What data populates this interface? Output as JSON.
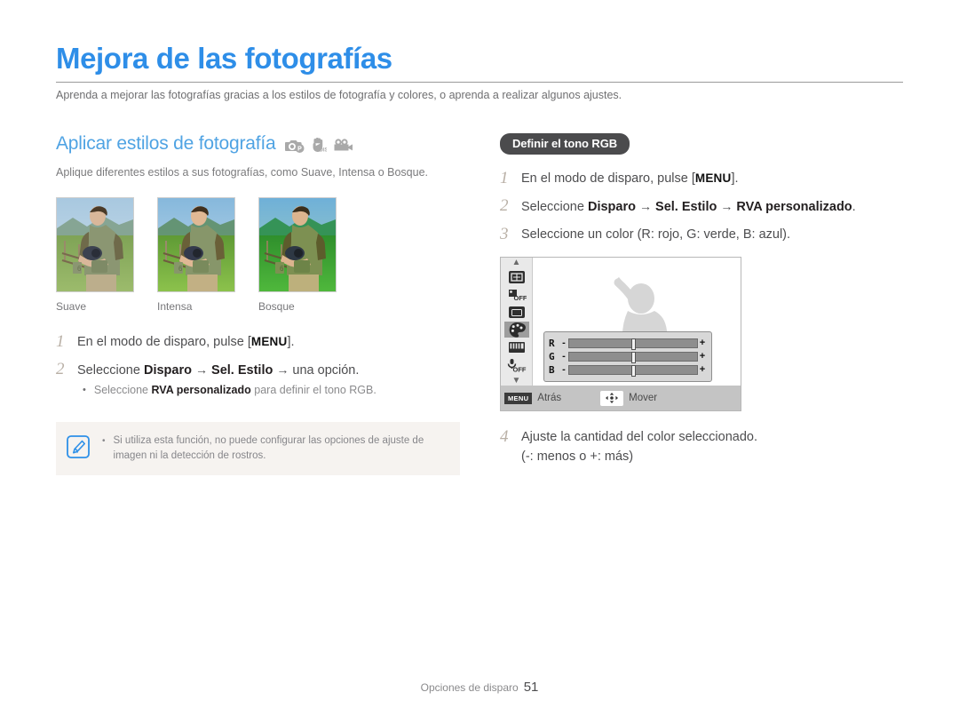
{
  "header": {
    "title": "Mejora de las fotografías",
    "intro": "Aprenda a mejorar las fotografías gracias a los estilos de fotografía y colores, o aprenda a realizar algunos ajustes."
  },
  "left": {
    "section_title": "Aplicar estilos de fotografía",
    "mode_icons": [
      "camera-p-icon",
      "hand-dis-icon",
      "video-camera-icon"
    ],
    "description": "Aplique diferentes estilos a sus fotografías, como Suave, Intensa o Bosque.",
    "thumbnails": [
      {
        "caption": "Suave"
      },
      {
        "caption": "Intensa"
      },
      {
        "caption": "Bosque"
      }
    ],
    "steps": [
      {
        "num": "1",
        "text_before": "En el modo de disparo, pulse [",
        "key": "MENU",
        "text_after": "]."
      },
      {
        "num": "2",
        "lead": "Seleccione ",
        "b1": "Disparo",
        "arrow1": "→",
        "b2": "Sel. Estilo",
        "arrow2": "→",
        "tail": "una opción.",
        "sub_bullet": "•",
        "sub_before": "Seleccione ",
        "sub_bold": "RVA personalizado",
        "sub_after": " para definir el tono RGB."
      }
    ],
    "note": {
      "icon": "note-pen-icon",
      "bullet": "•",
      "text": "Si utiliza esta función, no puede configurar las opciones de ajuste de imagen ni la detección de rostros."
    }
  },
  "right": {
    "badge": "Definir el tono RGB",
    "steps": [
      {
        "num": "1",
        "text_before": "En el modo de disparo, pulse [",
        "key": "MENU",
        "text_after": "]."
      },
      {
        "num": "2",
        "lead": "Seleccione ",
        "b1": "Disparo",
        "arrow1": "→",
        "b2": "Sel. Estilo",
        "arrow2": "→",
        "b3": "RVA personalizado",
        "tail": "."
      },
      {
        "num": "3",
        "text": "Seleccione un color (R: rojo, G: verde, B: azul)."
      },
      {
        "num": "4",
        "text": "Ajuste la cantidad del color seleccionado.",
        "text2": "(-: menos o +: más)"
      }
    ],
    "lcd": {
      "side_icons": [
        "chevron-up-icon",
        "focus-frame-icon",
        "flash-off-icon",
        "screen-frame-icon",
        "palette-icon",
        "white-balance-icon",
        "voice-off-icon",
        "chevron-down-icon"
      ],
      "selected_icon": "palette-icon",
      "sliders": [
        {
          "label": "R",
          "minus": "-",
          "plus": "+",
          "value": 50
        },
        {
          "label": "G",
          "minus": "-",
          "plus": "+",
          "value": 50
        },
        {
          "label": "B",
          "minus": "-",
          "plus": "+",
          "value": 50
        }
      ],
      "menu_key": "MENU",
      "back_label": "Atrás",
      "move_icon": "four-way-nav-icon",
      "move_label": "Mover"
    }
  },
  "footer": {
    "text": "Opciones de disparo",
    "page": "51"
  },
  "colors": {
    "title_blue": "#2e8ee8",
    "section_blue": "#4fa3e3",
    "note_bg": "#f6f3f0",
    "badge_dark": "#4b4b4d"
  }
}
